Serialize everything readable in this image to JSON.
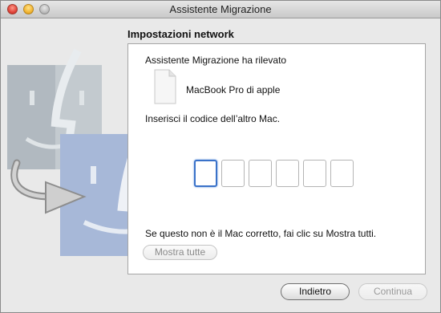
{
  "window": {
    "title": "Assistente Migrazione"
  },
  "section": {
    "title": "Impostazioni network"
  },
  "panel": {
    "detected_label": "Assistente Migrazione ha rilevato",
    "device_name": "MacBook Pro di apple",
    "enter_code_label": "Inserisci il codice dell’altro Mac.",
    "code_digits": [
      "",
      "",
      "",
      "",
      "",
      ""
    ],
    "hint": "Se questo non è il Mac corretto, fai clic su Mostra tutti.",
    "show_all_label": "Mostra tutte"
  },
  "buttons": {
    "back_label": "Indietro",
    "continue_label": "Continua"
  },
  "colors": {
    "focus_ring": "#3a72c9",
    "finder_back": "#b9c2c9",
    "finder_front": "#b4c4e0"
  },
  "icons": [
    "close-button",
    "minimize-button",
    "zoom-button",
    "finder-face-icon",
    "migration-arrow-icon",
    "document-icon"
  ]
}
